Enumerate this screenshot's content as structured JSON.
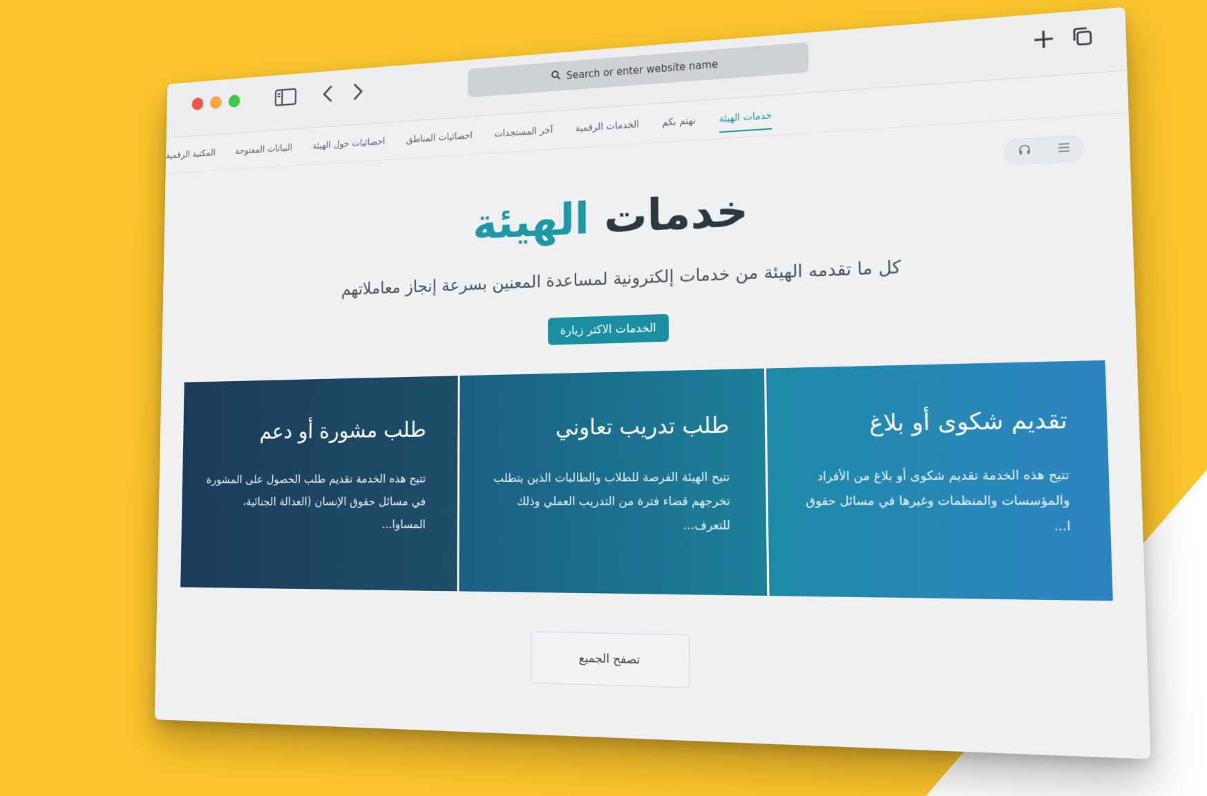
{
  "browser": {
    "address_placeholder": "Search or enter website name"
  },
  "nav": {
    "items": [
      {
        "label": "خدمات الهيئة",
        "active": true
      },
      {
        "label": "نهتم بكم",
        "active": false
      },
      {
        "label": "الخدمات الرقمية",
        "active": false
      },
      {
        "label": "آخر المستجدات",
        "active": false
      },
      {
        "label": "احصائيات المناطق",
        "active": false
      },
      {
        "label": "احصائيات حول الهيئة",
        "active": false
      },
      {
        "label": "البيانات المفتوحة",
        "active": false
      },
      {
        "label": "المكتبة الرقمية",
        "active": false
      }
    ]
  },
  "hero": {
    "title_main": "خدمات",
    "title_accent": "الهيئة",
    "subtitle": "كل ما تقدمه الهيئة من خدمات إلكترونية لمساعدة المعنين بسرعة إنجاز معاملاتهم",
    "cta_label": "الخدمات الاكثر زيارة"
  },
  "cards": [
    {
      "title": "تقديم شكوى أو بلاغ",
      "description": "تتيح هذه الخدمة تقديم شكوى أو بلاغ من الأفراد والمؤسسات والمنظمات وغيرها في مسائل حقوق ا..."
    },
    {
      "title": "طلب تدريب تعاوني",
      "description": "تتيح الهيئة الفرصة للطلاب والطالبات الذين يتطلب تخرجهم قضاء فترة من التدريب العملي وذلك للتعرف..."
    },
    {
      "title": "طلب مشورة أو دعم",
      "description": "تتيح هذه الخدمة تقديم طلب الحصول على المشورة في مسائل حقوق الإنسان (العدالة الجنائية، المساوا..."
    }
  ],
  "browse_all_label": "تصفح الجميع",
  "colors": {
    "background": "#fcc52c",
    "accent": "#1d98a5"
  }
}
